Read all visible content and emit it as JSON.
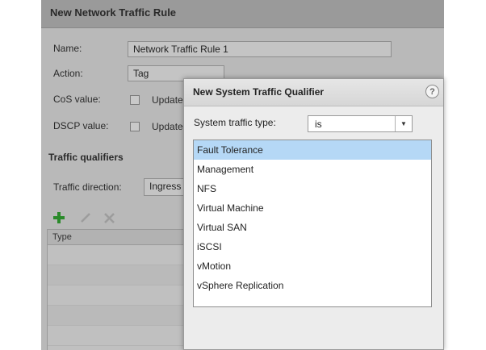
{
  "background_dialog": {
    "title": "New Network Traffic Rule",
    "name_label": "Name:",
    "name_value": "Network Traffic Rule 1",
    "action_label": "Action:",
    "action_value": "Tag",
    "cos_label": "CoS value:",
    "cos_update_label": "Update",
    "dscp_label": "DSCP value:",
    "dscp_update_label": "Update",
    "qualifiers_heading": "Traffic qualifiers",
    "direction_label": "Traffic direction:",
    "direction_value": "Ingress",
    "table_header_type": "Type"
  },
  "foreground_dialog": {
    "title": "New System Traffic Qualifier",
    "help_symbol": "?",
    "traffic_type_label": "System traffic type:",
    "operator_value": "is",
    "options": [
      "Fault Tolerance",
      "Management",
      "NFS",
      "Virtual Machine",
      "Virtual SAN",
      "iSCSI",
      "vMotion",
      "vSphere Replication"
    ],
    "selected_index": 0
  },
  "colors": {
    "selection": "#b5d8f6",
    "add_icon": "#2a8a2a"
  }
}
